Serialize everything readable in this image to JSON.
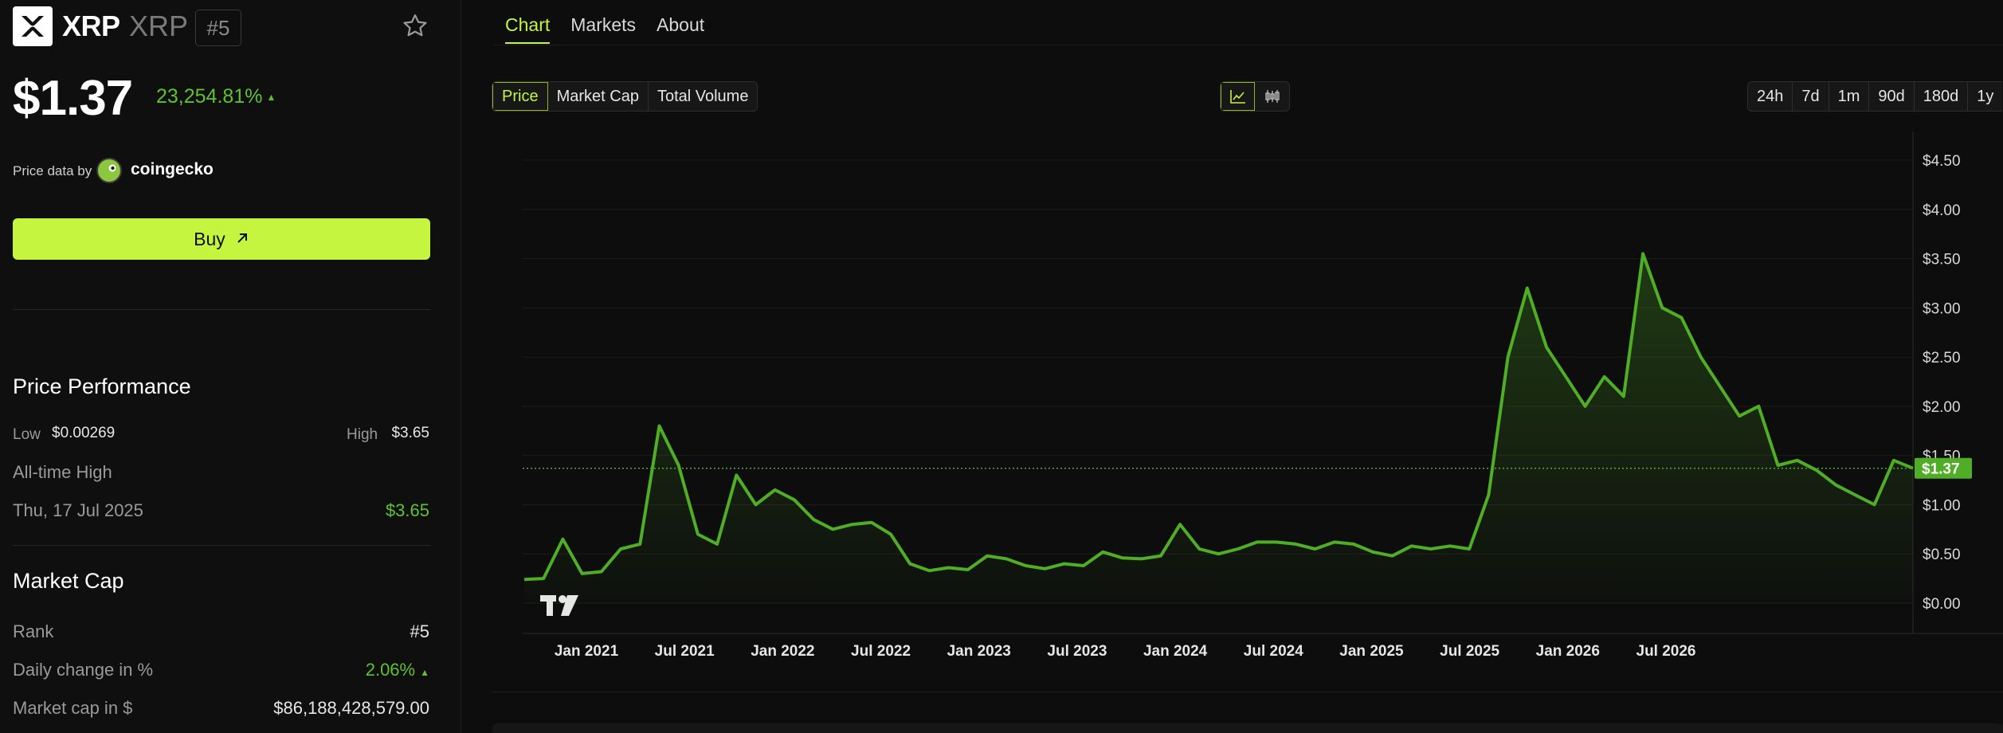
{
  "coin": {
    "name": "XRP",
    "symbol": "XRP",
    "rank_badge": "#5",
    "price": "$1.37",
    "change_pct": "23,254.81%",
    "change_arrow": "▲",
    "price_data_by": "Price data by",
    "provider": "coingecko",
    "buy_label": "Buy"
  },
  "performance": {
    "title": "Price Performance",
    "low_label": "Low",
    "low_value": "$0.00269",
    "high_label": "High",
    "high_value": "$3.65",
    "ath_label": "All-time High",
    "ath_date": "Thu, 17 Jul 2025",
    "ath_value": "$3.65"
  },
  "market_cap": {
    "title": "Market Cap",
    "rank_label": "Rank",
    "rank_value": "#5",
    "daily_change_label": "Daily change in %",
    "daily_change_value": "2.06%",
    "daily_change_arrow": "▲",
    "mcap_label": "Market cap in $",
    "mcap_value": "$86,188,428,579.00"
  },
  "tabs": [
    "Chart",
    "Markets",
    "About"
  ],
  "metric_options": [
    "Price",
    "Market Cap",
    "Total Volume"
  ],
  "range_options": [
    "24h",
    "7d",
    "1m",
    "90d",
    "180d",
    "1y"
  ],
  "icons": {
    "logo": "xrp-logo-icon",
    "star": "star-icon",
    "gecko": "coingecko-logo-icon",
    "buy_arrow": "arrow-up-right-icon",
    "line_chart": "line-chart-icon",
    "candle_chart": "candlestick-chart-icon",
    "tradingview": "tradingview-logo-icon"
  },
  "colors": {
    "accent": "#c5f53e",
    "positive": "#5fc22f",
    "line": "#4fae25",
    "background": "#0d0d0d"
  },
  "chart_data": {
    "type": "area",
    "title": "",
    "xlabel": "",
    "ylabel": "",
    "ylim": [
      0,
      4.5
    ],
    "y_ticks": [
      "$0.00",
      "$0.50",
      "$1.00",
      "$1.50",
      "$2.00",
      "$2.50",
      "$3.00",
      "$3.50",
      "$4.00",
      "$4.50"
    ],
    "x_ticks": [
      "Jan 2021",
      "Jul 2021",
      "Jan 2022",
      "Jul 2022",
      "Jan 2023",
      "Jul 2023",
      "Jan 2024",
      "Jul 2024",
      "Jan 2025",
      "Jul 2025",
      "Jan 2026",
      "Jul 2026"
    ],
    "current_price_label": "$1.37",
    "current_price": 1.37,
    "x": [
      "2020-09",
      "2020-10",
      "2020-11",
      "2020-12",
      "2021-01",
      "2021-02",
      "2021-03",
      "2021-04",
      "2021-05",
      "2021-06",
      "2021-07",
      "2021-08",
      "2021-09",
      "2021-10",
      "2021-11",
      "2021-12",
      "2022-01",
      "2022-02",
      "2022-03",
      "2022-04",
      "2022-05",
      "2022-06",
      "2022-07",
      "2022-08",
      "2022-09",
      "2022-10",
      "2022-11",
      "2022-12",
      "2023-01",
      "2023-02",
      "2023-03",
      "2023-04",
      "2023-05",
      "2023-06",
      "2023-07",
      "2023-08",
      "2023-09",
      "2023-10",
      "2023-11",
      "2023-12",
      "2024-01",
      "2024-02",
      "2024-03",
      "2024-04",
      "2024-05",
      "2024-06",
      "2024-07",
      "2024-08",
      "2024-09",
      "2024-10",
      "2024-11",
      "2024-12",
      "2025-01",
      "2025-02",
      "2025-03",
      "2025-04",
      "2025-05",
      "2025-06",
      "2025-07",
      "2025-08",
      "2025-09",
      "2025-10",
      "2025-11",
      "2025-12",
      "2026-01",
      "2026-02",
      "2026-03",
      "2026-04",
      "2026-05",
      "2026-06",
      "2026-07",
      "2026-08",
      "2026-09"
    ],
    "values": [
      0.24,
      0.25,
      0.65,
      0.3,
      0.32,
      0.55,
      0.6,
      1.8,
      1.4,
      0.7,
      0.6,
      1.3,
      1.0,
      1.15,
      1.05,
      0.85,
      0.75,
      0.8,
      0.82,
      0.7,
      0.4,
      0.33,
      0.36,
      0.34,
      0.48,
      0.45,
      0.38,
      0.35,
      0.4,
      0.38,
      0.52,
      0.46,
      0.45,
      0.48,
      0.8,
      0.55,
      0.5,
      0.55,
      0.62,
      0.62,
      0.6,
      0.55,
      0.62,
      0.6,
      0.52,
      0.48,
      0.58,
      0.55,
      0.58,
      0.55,
      1.1,
      2.5,
      3.2,
      2.6,
      2.3,
      2.0,
      2.3,
      2.1,
      3.55,
      3.0,
      2.9,
      2.5,
      2.2,
      1.9,
      2.0,
      1.4,
      1.45,
      1.35,
      1.2,
      1.1,
      1.0,
      1.45,
      1.37
    ]
  }
}
